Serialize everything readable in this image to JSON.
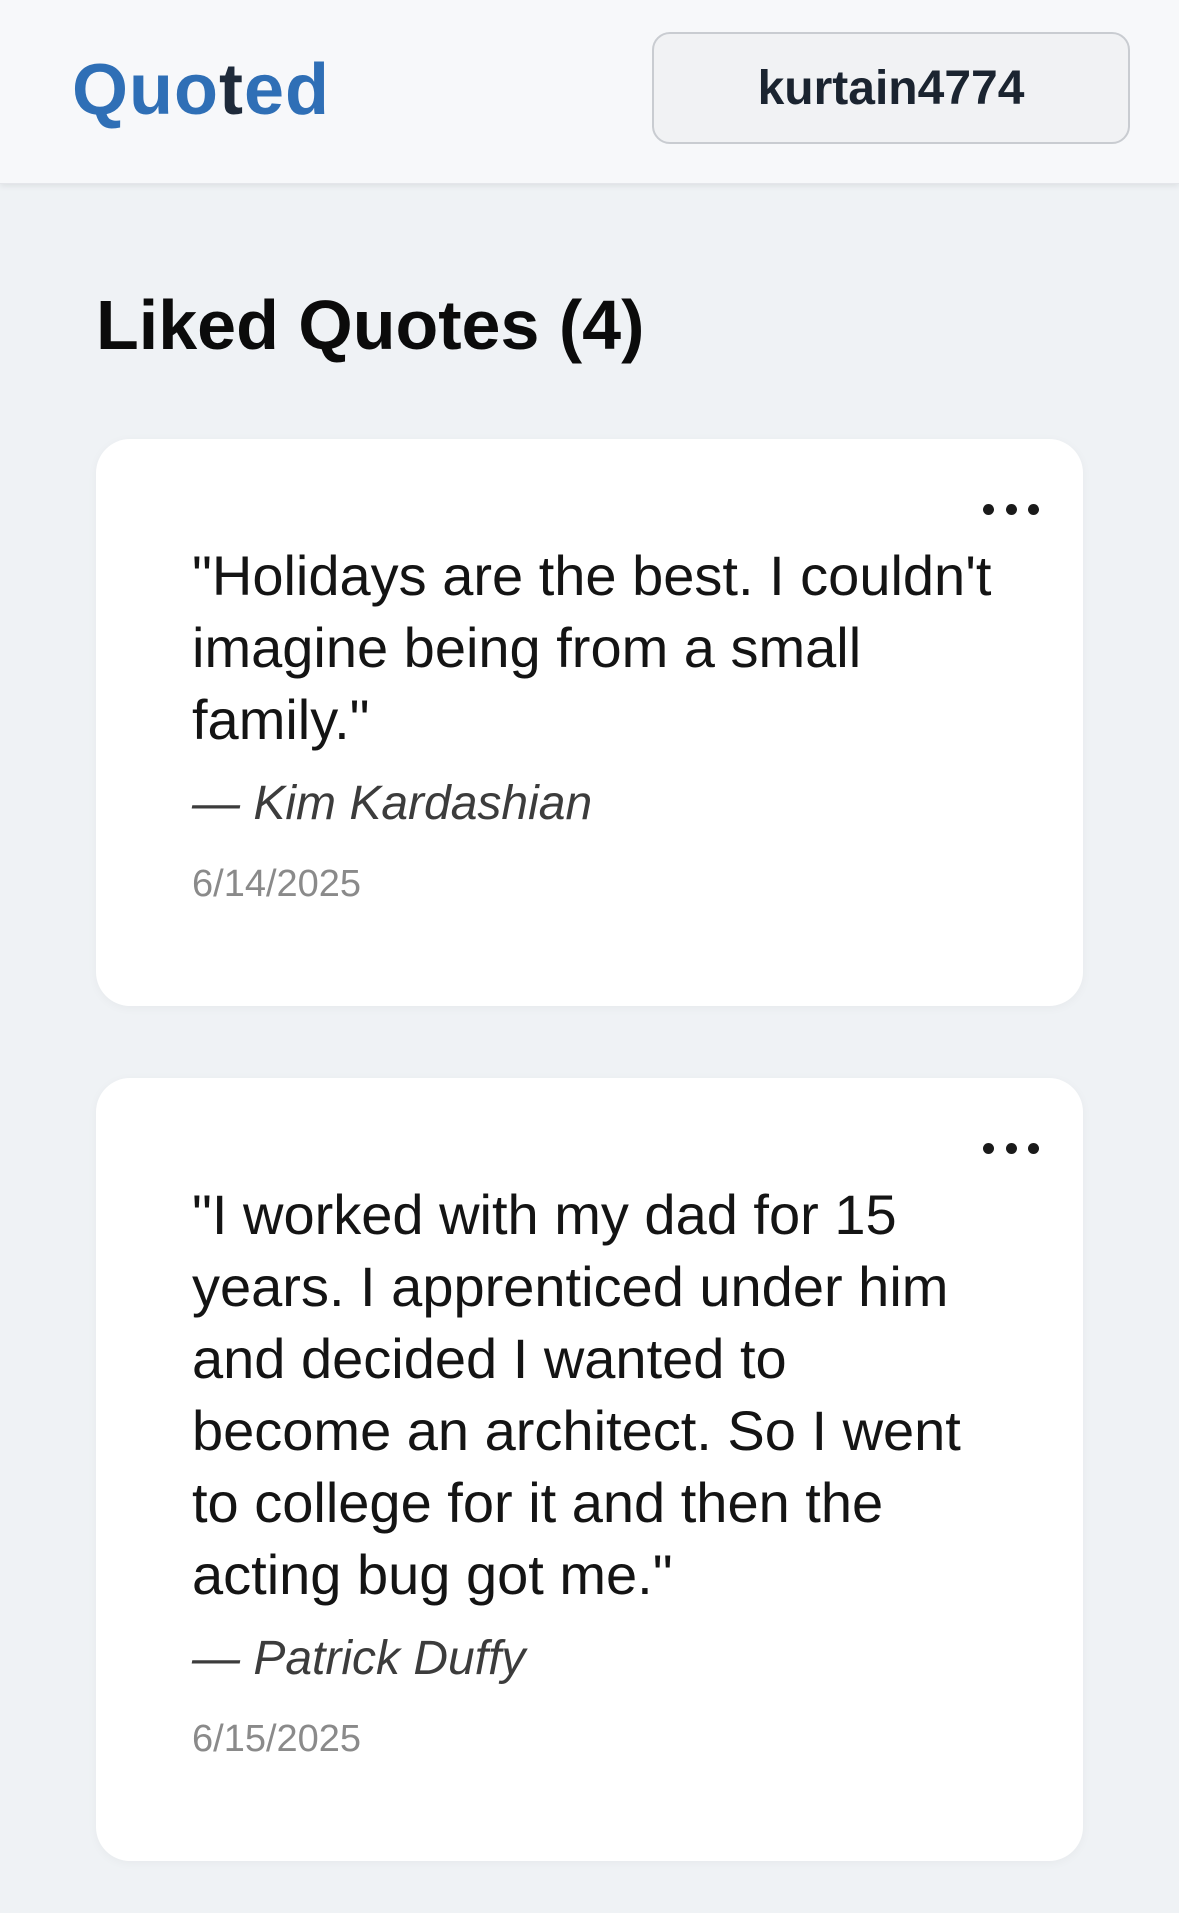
{
  "header": {
    "brand_quo": "Quo",
    "brand_t": "t",
    "brand_ed": "ed",
    "username": "kurtain4774"
  },
  "page": {
    "title": "Liked Quotes (4)"
  },
  "quotes": [
    {
      "text": "\"Holidays are the best. I couldn't imagine being from a small family.\"",
      "author": "— Kim Kardashian",
      "date": "6/14/2025"
    },
    {
      "text": "\"I worked with my dad for 15 years. I apprenticed under him and decided I wanted to become an architect. So I went to college for it and then the acting bug got me.\"",
      "author": "— Patrick Duffy",
      "date": "6/15/2025"
    }
  ],
  "icons": {
    "more": "more-horizontal-icon"
  },
  "colors": {
    "brand_blue": "#2f6fb6",
    "brand_dark": "#1e2a3a",
    "background": "#eff2f5"
  }
}
